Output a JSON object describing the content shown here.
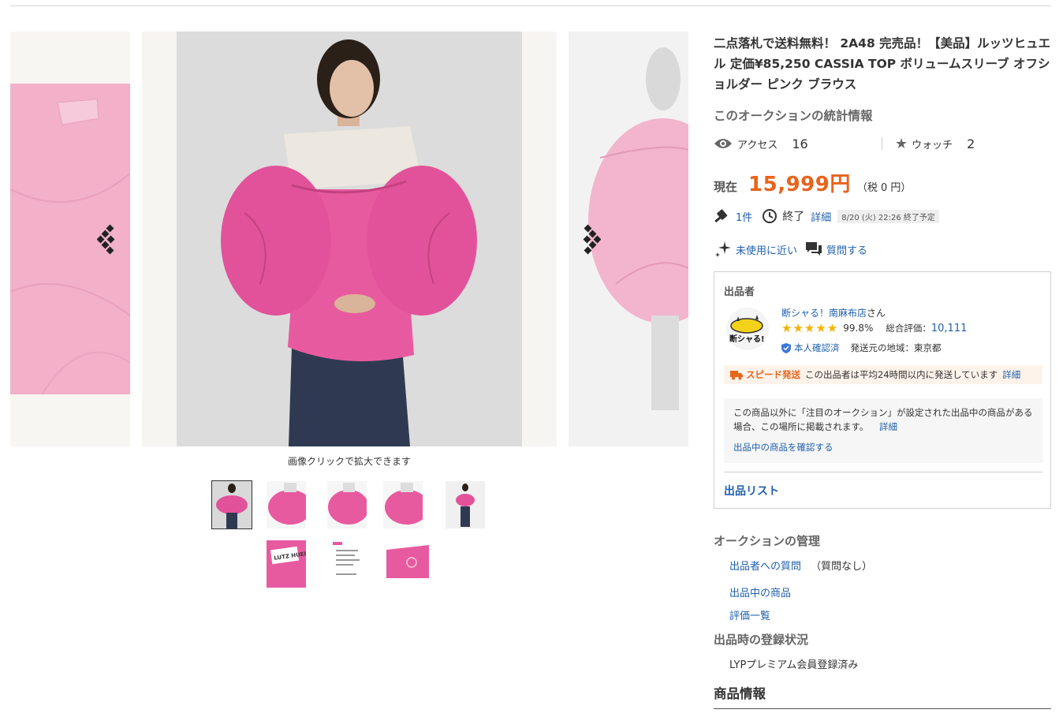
{
  "gallery": {
    "zoom_hint": "画像クリックで拡大できます",
    "thumbnails": [
      {
        "label": "thumbnail-1",
        "active": true
      },
      {
        "label": "thumbnail-2",
        "active": false
      },
      {
        "label": "thumbnail-3",
        "active": false
      },
      {
        "label": "thumbnail-4",
        "active": false
      },
      {
        "label": "thumbnail-5",
        "active": false
      },
      {
        "label": "thumbnail-6",
        "active": false
      },
      {
        "label": "thumbnail-7",
        "active": false
      },
      {
        "label": "thumbnail-8",
        "active": false
      }
    ],
    "brand_tag_text": "LUTZ HUELLE"
  },
  "item": {
    "title": "二点落札で送料無料！ 2A48 完売品！【美品】ルッツヒュエル 定価¥85,250 CASSIA TOP ボリュームスリーブ オフショルダー ピンク ブラウス",
    "stats_heading": "このオークションの統計情報",
    "access_label": "アクセス",
    "access_count": "16",
    "watch_label": "ウォッチ",
    "watch_count": "2",
    "price_label": "現在",
    "price": "15,999円",
    "tax": "（税 0 円）",
    "bids": "1件",
    "end_label": "終了",
    "detail_link": "詳細",
    "end_time": "8/20 (火) 22:26 終了予定",
    "condition": "未使用に近い",
    "ask_question": "質問する"
  },
  "seller": {
    "heading": "出品者",
    "avatar_text": "断シャる!",
    "name": "断シャる！南麻布店",
    "name_suffix": "さん",
    "stars": "★★★★★",
    "rating_percent": "99.8%",
    "rating_total_label": "総合評価：",
    "rating_total": "10,111",
    "verified": "本人確認済",
    "ship_from": "発送元の地域：東京都",
    "speed_label": "スピード発送",
    "speed_text": "この出品者は平均24時間以内に発送しています",
    "speed_detail": "詳細",
    "notice_text": "この商品以外に「注目のオークション」が設定された出品中の商品がある場合、この場所に掲載されます。",
    "notice_detail": "詳細",
    "notice_link": "出品中の商品を確認する",
    "listing_link": "出品リスト"
  },
  "management": {
    "heading": "オークションの管理",
    "question_link": "出品者への質問",
    "question_note": "（質問なし）",
    "listed_items": "出品中の商品",
    "ratings": "評価一覧"
  },
  "registration": {
    "heading": "出品時の登録状況",
    "status": "LYPプレミアム会員登録済み"
  },
  "product_info": {
    "heading": "商品情報"
  },
  "colors": {
    "price": "#e8641b",
    "link": "#1f5fae",
    "blouse_pink": "#e85aa0",
    "star": "#f3b300"
  }
}
